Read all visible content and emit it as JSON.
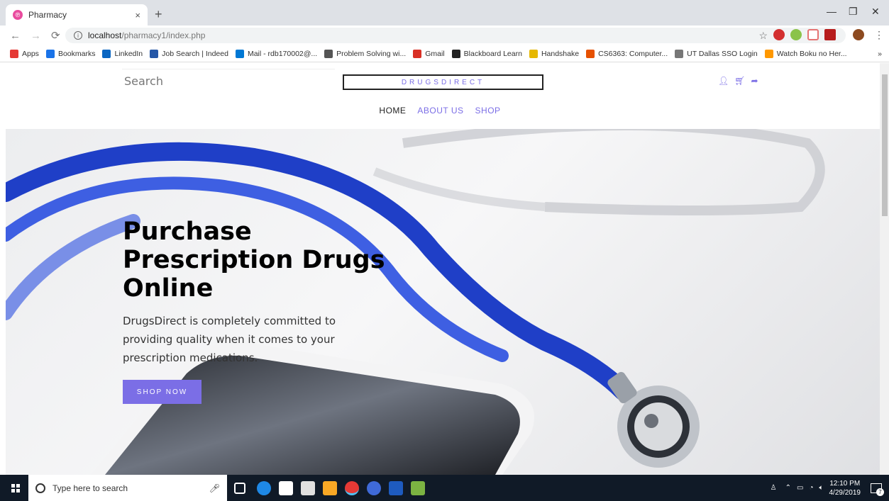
{
  "browser": {
    "tab_title": "Pharmacy",
    "tab_close": "×",
    "new_tab": "+",
    "url_host": "localhost",
    "url_path": "/pharmacy1/index.php",
    "bookmarks": [
      {
        "label": "Apps",
        "color": "#e53935"
      },
      {
        "label": "Bookmarks",
        "color": "#1a73e8"
      },
      {
        "label": "LinkedIn",
        "color": "#0a66c2"
      },
      {
        "label": "Job Search | Indeed",
        "color": "#2557a7"
      },
      {
        "label": "Mail - rdb170002@...",
        "color": "#0078d4"
      },
      {
        "label": "Problem Solving wi...",
        "color": "#555555"
      },
      {
        "label": "Gmail",
        "color": "#d93025"
      },
      {
        "label": "Blackboard Learn",
        "color": "#222222"
      },
      {
        "label": "Handshake",
        "color": "#e6b800"
      },
      {
        "label": "CS6363: Computer...",
        "color": "#e65100"
      },
      {
        "label": "UT Dallas SSO Login",
        "color": "#777777"
      },
      {
        "label": "Watch Boku no Her...",
        "color": "#ff9800"
      }
    ],
    "bookmarks_more": "»"
  },
  "site": {
    "search_placeholder": "Search",
    "logo": "DRUGSDIRECT",
    "nav": [
      "HOME",
      "ABOUT US",
      "SHOP"
    ],
    "accent_color": "#7b6ee6"
  },
  "hero": {
    "title": "Purchase Prescription Drugs Online",
    "description": "DrugsDirect is completely committed to providing quality when it comes to your prescription medications.",
    "button": "SHOP NOW"
  },
  "taskbar": {
    "search_placeholder": "Type here to search",
    "time": "12:10 PM",
    "date": "4/29/2019",
    "notifications": "7"
  }
}
